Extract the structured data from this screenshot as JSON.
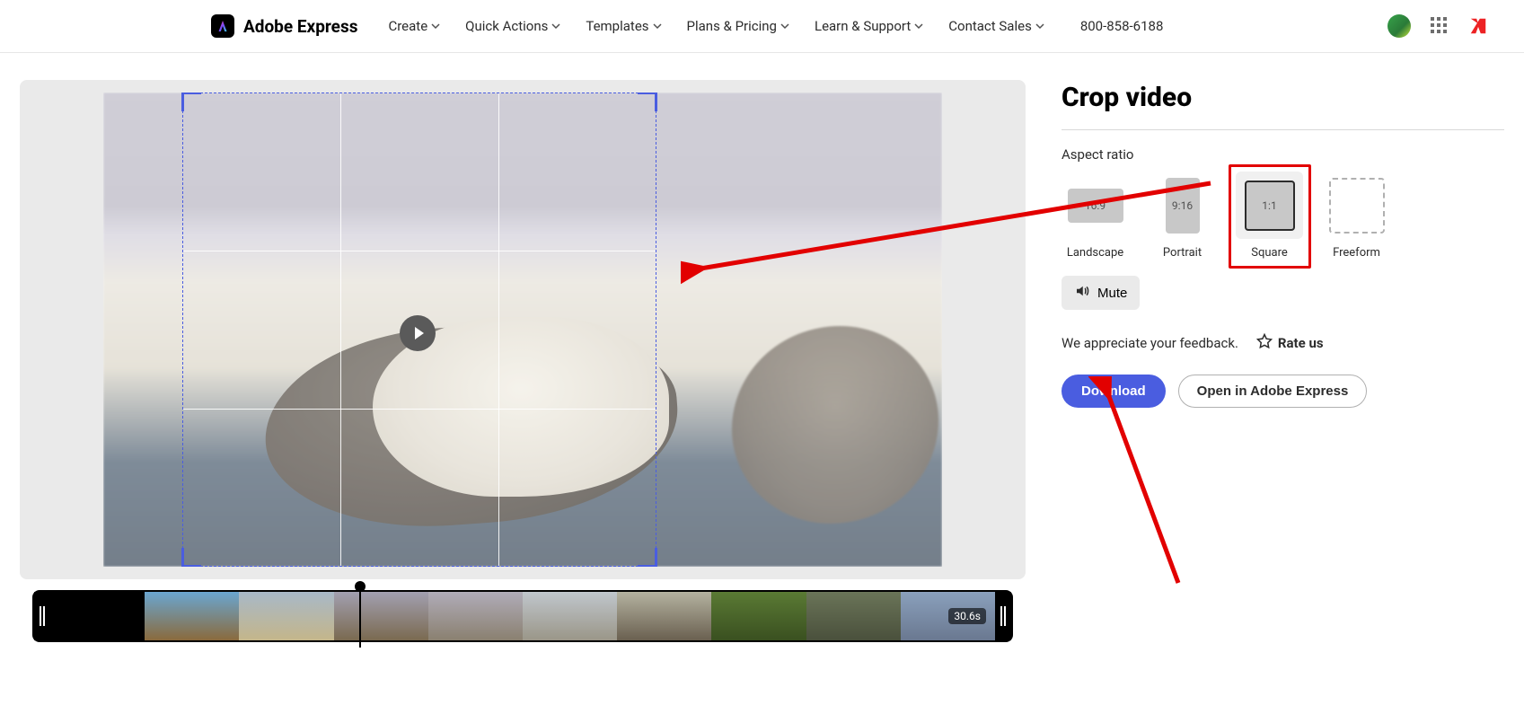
{
  "brand": {
    "name": "Adobe Express"
  },
  "nav": {
    "items": [
      {
        "label": "Create"
      },
      {
        "label": "Quick Actions"
      },
      {
        "label": "Templates"
      },
      {
        "label": "Plans & Pricing"
      },
      {
        "label": "Learn & Support"
      },
      {
        "label": "Contact Sales"
      }
    ],
    "phone": "800-858-6188"
  },
  "panel": {
    "title": "Crop video",
    "aspect_label": "Aspect ratio",
    "ratios": {
      "landscape": {
        "value": "16:9",
        "label": "Landscape"
      },
      "portrait": {
        "value": "9:16",
        "label": "Portrait"
      },
      "square": {
        "value": "1:1",
        "label": "Square"
      },
      "freeform": {
        "value": "",
        "label": "Freeform"
      }
    },
    "mute": "Mute",
    "feedback_text": "We appreciate your feedback.",
    "rate_us": "Rate us",
    "download": "Download",
    "open_in": "Open in Adobe Express"
  },
  "timeline": {
    "duration": "30.6s"
  }
}
